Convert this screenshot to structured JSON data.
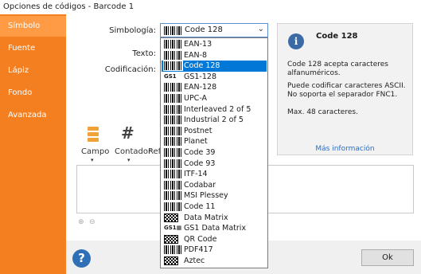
{
  "window": {
    "title": "Opciones de códigos - Barcode 1"
  },
  "sidebar": {
    "items": [
      {
        "label": "Símbolo",
        "active": true
      },
      {
        "label": "Fuente",
        "active": false
      },
      {
        "label": "Lápiz",
        "active": false
      },
      {
        "label": "Fondo",
        "active": false
      },
      {
        "label": "Avanzada",
        "active": false
      }
    ]
  },
  "form": {
    "symbology_label": "Simbología:",
    "text_label": "Texto:",
    "encoding_label": "Codificación:",
    "symbology_value": "Code 128"
  },
  "info_panel": {
    "title": "Code 128",
    "paragraph1": "Code 128 acepta caracteres alfanuméricos.",
    "paragraph2_line1": "Puede codificar caracteres ASCII.",
    "paragraph2_line2": "No soporta el separador FNC1.",
    "paragraph3": "Max. 48 caracteres.",
    "more_link": "Más información"
  },
  "toolbar": {
    "field_label": "Campo",
    "counter_label": "Contador",
    "ref_label": "Ref"
  },
  "dropdown": {
    "selected_index": 2,
    "options": [
      {
        "label": "EAN-13",
        "icon": "barcode-icon"
      },
      {
        "label": "EAN-8",
        "icon": "barcode-icon"
      },
      {
        "label": "Code 128",
        "icon": "barcode-icon"
      },
      {
        "label": "GS1-128",
        "icon": "gs1-icon"
      },
      {
        "label": "EAN-128",
        "icon": "barcode-icon"
      },
      {
        "label": "UPC-A",
        "icon": "barcode-icon"
      },
      {
        "label": "Interleaved 2 of 5",
        "icon": "barcode-icon"
      },
      {
        "label": "Industrial 2 of 5",
        "icon": "barcode-icon"
      },
      {
        "label": "Postnet",
        "icon": "barcode-icon"
      },
      {
        "label": "Planet",
        "icon": "barcode-icon"
      },
      {
        "label": "Code 39",
        "icon": "barcode-icon"
      },
      {
        "label": "Code 93",
        "icon": "barcode-icon"
      },
      {
        "label": "ITF-14",
        "icon": "barcode-icon"
      },
      {
        "label": "Codabar",
        "icon": "barcode-icon"
      },
      {
        "label": "MSI Plessey",
        "icon": "barcode-icon"
      },
      {
        "label": "Code 11",
        "icon": "barcode-icon"
      },
      {
        "label": "Data Matrix",
        "icon": "matrix-icon"
      },
      {
        "label": "GS1 Data Matrix",
        "icon": "gs1-matrix-icon"
      },
      {
        "label": "QR Code",
        "icon": "qr-icon"
      },
      {
        "label": "PDF417",
        "icon": "pdf417-icon"
      },
      {
        "label": "Aztec",
        "icon": "aztec-icon"
      }
    ]
  },
  "buttons": {
    "ok_label": "Ok",
    "help_label": "?"
  },
  "colors": {
    "sidebar": "#f47f20",
    "sidebar_active": "#ff9b45",
    "selection": "#0078d7",
    "link": "#2d6cc0",
    "help": "#2f6fb5"
  }
}
